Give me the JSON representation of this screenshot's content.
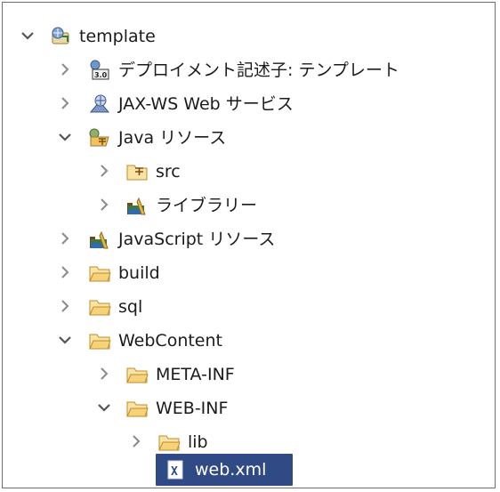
{
  "tree": {
    "items": [
      {
        "label": "template",
        "icon": "web-project-icon",
        "state": "expanded"
      },
      {
        "label": "デプロイメント記述子: テンプレート",
        "icon": "deployment-descriptor-icon",
        "state": "collapsed"
      },
      {
        "label": "JAX-WS Web サービス",
        "icon": "web-service-icon",
        "state": "collapsed"
      },
      {
        "label": "Java リソース",
        "icon": "java-resources-icon",
        "state": "expanded"
      },
      {
        "label": "src",
        "icon": "source-folder-icon",
        "state": "collapsed"
      },
      {
        "label": "ライブラリー",
        "icon": "library-icon",
        "state": "collapsed"
      },
      {
        "label": "JavaScript リソース",
        "icon": "library-icon",
        "state": "collapsed"
      },
      {
        "label": "build",
        "icon": "folder-icon",
        "state": "collapsed"
      },
      {
        "label": "sql",
        "icon": "folder-icon",
        "state": "collapsed"
      },
      {
        "label": "WebContent",
        "icon": "folder-icon",
        "state": "expanded"
      },
      {
        "label": "META-INF",
        "icon": "folder-icon",
        "state": "collapsed"
      },
      {
        "label": "WEB-INF",
        "icon": "folder-icon",
        "state": "expanded"
      },
      {
        "label": "lib",
        "icon": "folder-icon",
        "state": "collapsed"
      },
      {
        "label": "web.xml",
        "icon": "xml-file-icon",
        "state": "leaf",
        "selected": true
      }
    ]
  },
  "colors": {
    "selection": "#2f4a84",
    "folder": "#f3c25e",
    "chevron": "#555555"
  }
}
